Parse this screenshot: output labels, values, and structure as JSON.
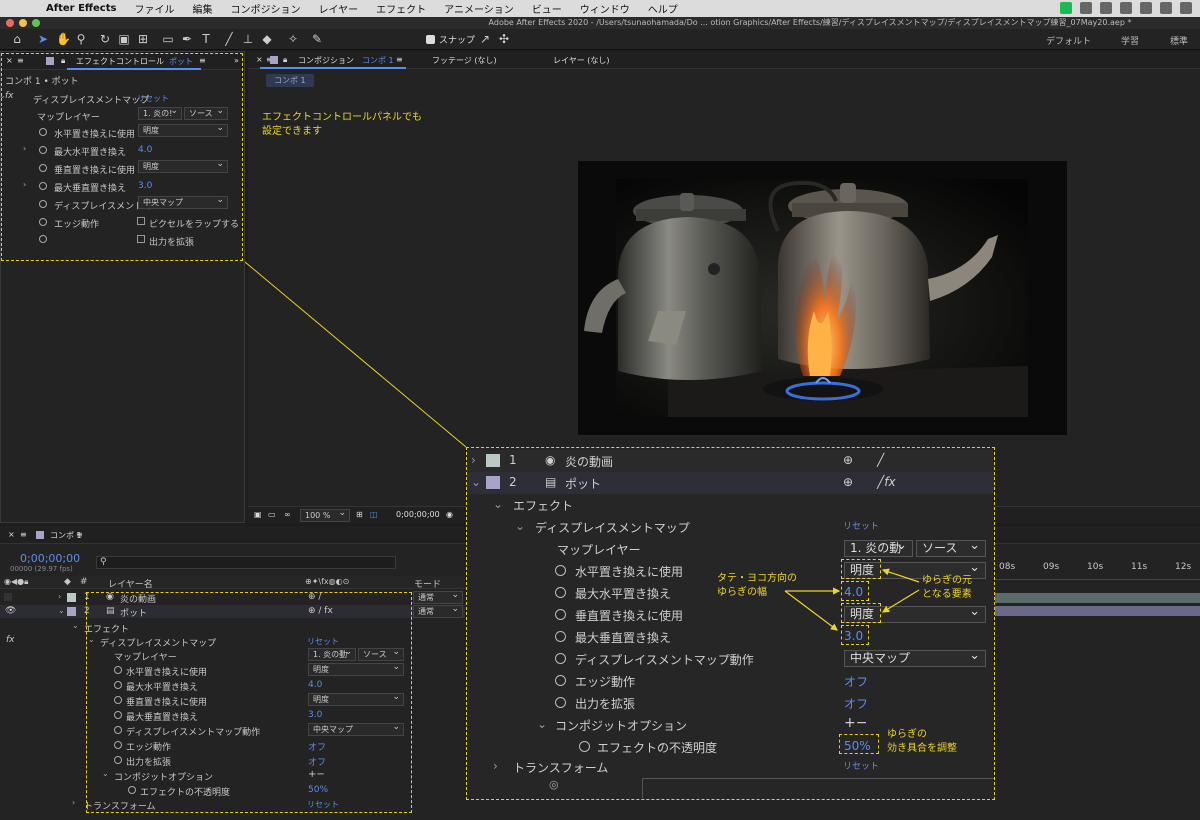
{
  "menubar": {
    "app_name": "After Effects",
    "items": [
      "ファイル",
      "編集",
      "コンポジション",
      "レイヤー",
      "エフェクト",
      "アニメーション",
      "ビュー",
      "ウィンドウ",
      "ヘルプ"
    ]
  },
  "titlebar": {
    "title": "Adobe After Effects 2020 - /Users/tsunaohamada/Do ... otion Graphics/After Effects/練習/ディスプレイスメントマップ/ディスプレイスメントマップ練習_07May20.aep *"
  },
  "toolbar": {
    "snap_label": "スナップ",
    "workspaces": [
      "デフォルト",
      "学習",
      "標準"
    ]
  },
  "effect_controls": {
    "tab_label": "エフェクトコントロール",
    "tab_layer": "ポット",
    "breadcrumb": "コンポ 1 • ポット",
    "effect_name": "ディスプレイスメントマップ",
    "reset_label": "リセット",
    "map_layer_label": "マップレイヤー",
    "map_layer_value": "1. 炎の!",
    "map_layer_source": "ソース",
    "h_use_label": "水平置き換えに使用",
    "h_use_value": "明度",
    "h_max_label": "最大水平置き換え",
    "h_max_value": "4.0",
    "v_use_label": "垂直置き換えに使用",
    "v_use_value": "明度",
    "v_max_label": "最大垂直置き換え",
    "v_max_value": "3.0",
    "behavior_label": "ディスプレイスメントマ",
    "behavior_value": "中央マップ",
    "edge_label": "エッジ動作",
    "edge_option": "ピクセルをラップする",
    "expand_option": "出力を拡張"
  },
  "comp_viewer": {
    "tab_label": "コンポジション",
    "tab_comp": "コンポ 1",
    "footage_tab": "フッテージ (なし)",
    "layer_tab": "レイヤー (なし)",
    "sub_tab": "コンポ 1",
    "zoom": "100 %",
    "timecode": "0;00;00;00",
    "annotation_line1": "エフェクトコントロールパネルでも",
    "annotation_line2": "設定できます"
  },
  "timeline": {
    "tab_label": "コンポ 1",
    "timecode": "0;00;00;00",
    "frames": "00000 (29.97 fps)",
    "search_icon": "search-icon",
    "col_layer_name": "レイヤー名",
    "col_mode": "モード",
    "ruler_ticks": [
      "08s",
      "09s",
      "10s",
      "11s",
      "12s"
    ],
    "layers": [
      {
        "num": "1",
        "name": "炎の動画",
        "mode": "通常",
        "color": "#b9c9c5"
      },
      {
        "num": "2",
        "name": "ポット",
        "mode": "通常",
        "color": "#a7a3c9"
      }
    ],
    "effects_label": "エフェクト",
    "effect_name": "ディスプレイスメントマップ",
    "reset_label": "リセット",
    "map_layer_label": "マップレイヤー",
    "map_layer_value": "1. 炎の動",
    "map_layer_source": "ソース",
    "h_use_label": "水平置き換えに使用",
    "h_use_value": "明度",
    "h_max_label": "最大水平置き換え",
    "h_max_value": "4.0",
    "v_use_label": "垂直置き換えに使用",
    "v_use_value": "明度",
    "v_max_label": "最大垂直置き換え",
    "v_max_value": "3.0",
    "behavior_label": "ディスプレイスメントマップ動作",
    "behavior_value": "中央マップ",
    "edge_label": "エッジ動作",
    "edge_value": "オフ",
    "expand_label": "出力を拡張",
    "expand_value": "オフ",
    "composite_label": "コンポジットオプション",
    "composite_add": "+−",
    "opacity_label": "エフェクトの不透明度",
    "opacity_value": "50%",
    "transform_label": "トランスフォーム",
    "transform_reset": "リセット"
  },
  "zoom_panel": {
    "layers": [
      {
        "num": "1",
        "name": "炎の動画",
        "color": "#b9c9c5"
      },
      {
        "num": "2",
        "name": "ポット",
        "color": "#a7a3c9"
      }
    ],
    "effects_label": "エフェクト",
    "effect_name": "ディスプレイスメントマップ",
    "reset_label": "リセット",
    "map_layer_label": "マップレイヤー",
    "map_layer_value": "1. 炎の動",
    "map_layer_source": "ソース",
    "h_use_label": "水平置き換えに使用",
    "h_use_value": "明度",
    "h_max_label": "最大水平置き換え",
    "h_max_value": "4.0",
    "v_use_label": "垂直置き換えに使用",
    "v_use_value": "明度",
    "v_max_label": "最大垂直置き換え",
    "v_max_value": "3.0",
    "behavior_label": "ディスプレイスメントマップ動作",
    "behavior_value": "中央マップ",
    "edge_label": "エッジ動作",
    "edge_value": "オフ",
    "expand_label": "出力を拡張",
    "expand_value": "オフ",
    "composite_label": "コンポジットオプション",
    "composite_add": "+−",
    "opacity_label": "エフェクトの不透明度",
    "opacity_value": "50%",
    "transform_label": "トランスフォーム",
    "transform_reset": "リセット",
    "annot_width_1": "タテ・ヨコ方向の",
    "annot_width_2": "ゆらぎの幅",
    "annot_source_1": "ゆらぎの元",
    "annot_source_2": "となる要素",
    "annot_opacity_1": "ゆらぎの",
    "annot_opacity_2": "効き具合を調整"
  },
  "colors": {
    "accent_blue": "#5a8dee",
    "highlight_yellow": "#e8d025",
    "panel_bg": "#232323"
  }
}
